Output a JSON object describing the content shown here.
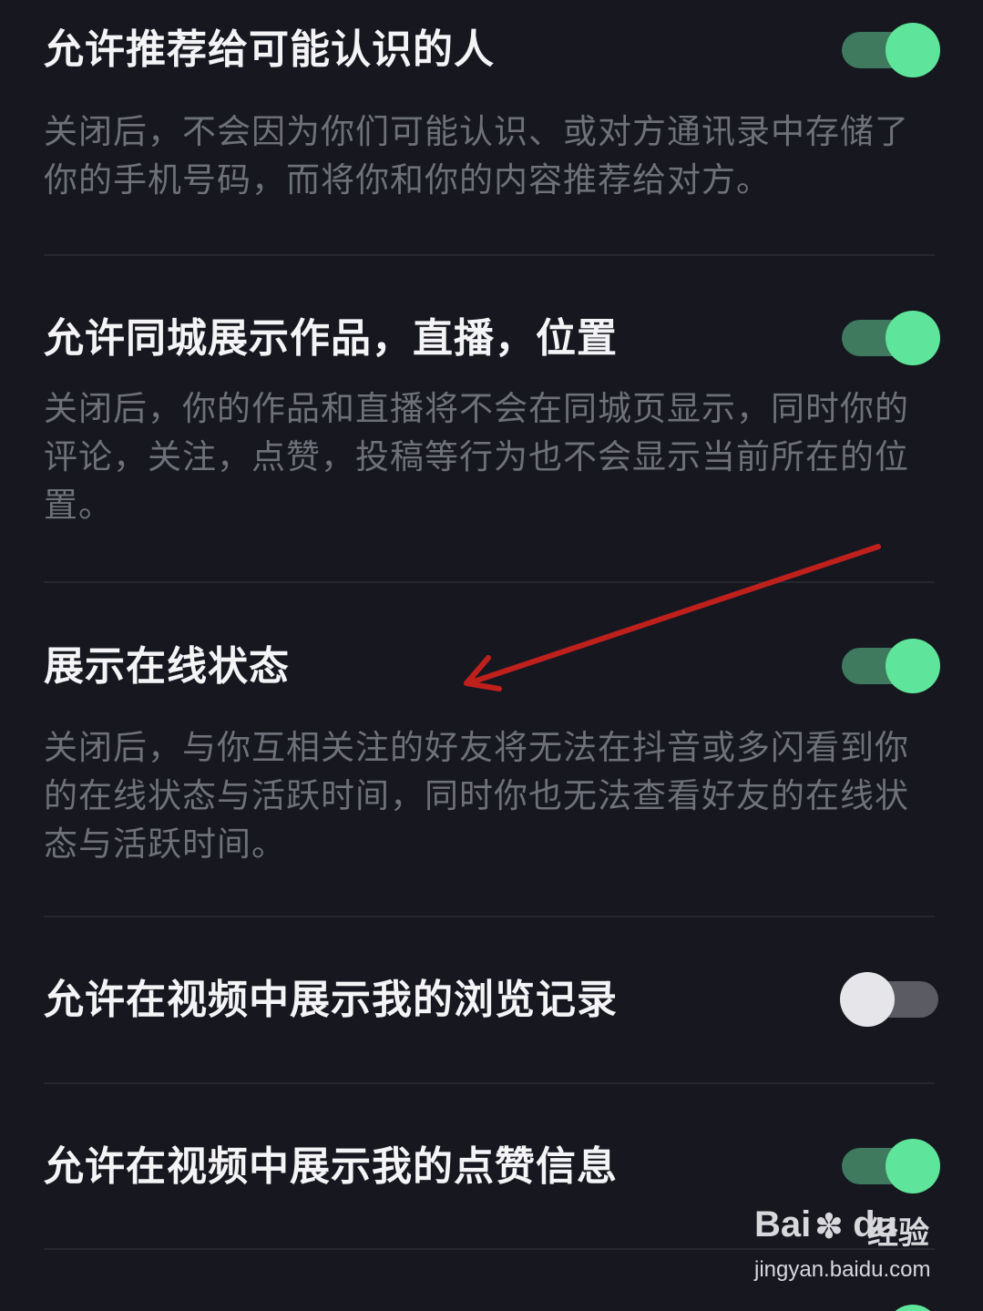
{
  "settings": [
    {
      "title": "允许推荐给可能认识的人",
      "description": "关闭后，不会因为你们可能认识、或对方通讯录中存储了你的手机号码，而将你和你的内容推荐给对方。",
      "enabled": true
    },
    {
      "title": "允许同城展示作品，直播，位置",
      "description": "关闭后，你的作品和直播将不会在同城页显示，同时你的评论，关注，点赞，投稿等行为也不会显示当前所在的位置。",
      "enabled": true
    },
    {
      "title": "展示在线状态",
      "description": "关闭后，与你互相关注的好友将无法在抖音或多闪看到你的在线状态与活跃时间，同时你也无法查看好友的在线状态与活跃时间。",
      "enabled": true
    },
    {
      "title": "允许在视频中展示我的浏览记录",
      "enabled": false
    },
    {
      "title": "允许在视频中展示我的点赞信息",
      "enabled": true
    }
  ],
  "colors": {
    "background": "#16171f",
    "toggle_on": "#5fe59b",
    "toggle_off": "#e6e6ea",
    "annotation_arrow": "#c0201c"
  },
  "annotation": {
    "type": "arrow",
    "points_to": "展示在线状态"
  },
  "watermark": {
    "brand_latin_a": "Bai",
    "brand_latin_b": "du",
    "brand_cn": "经验",
    "url": "jingyan.baidu.com",
    "icon": "paw-icon"
  }
}
